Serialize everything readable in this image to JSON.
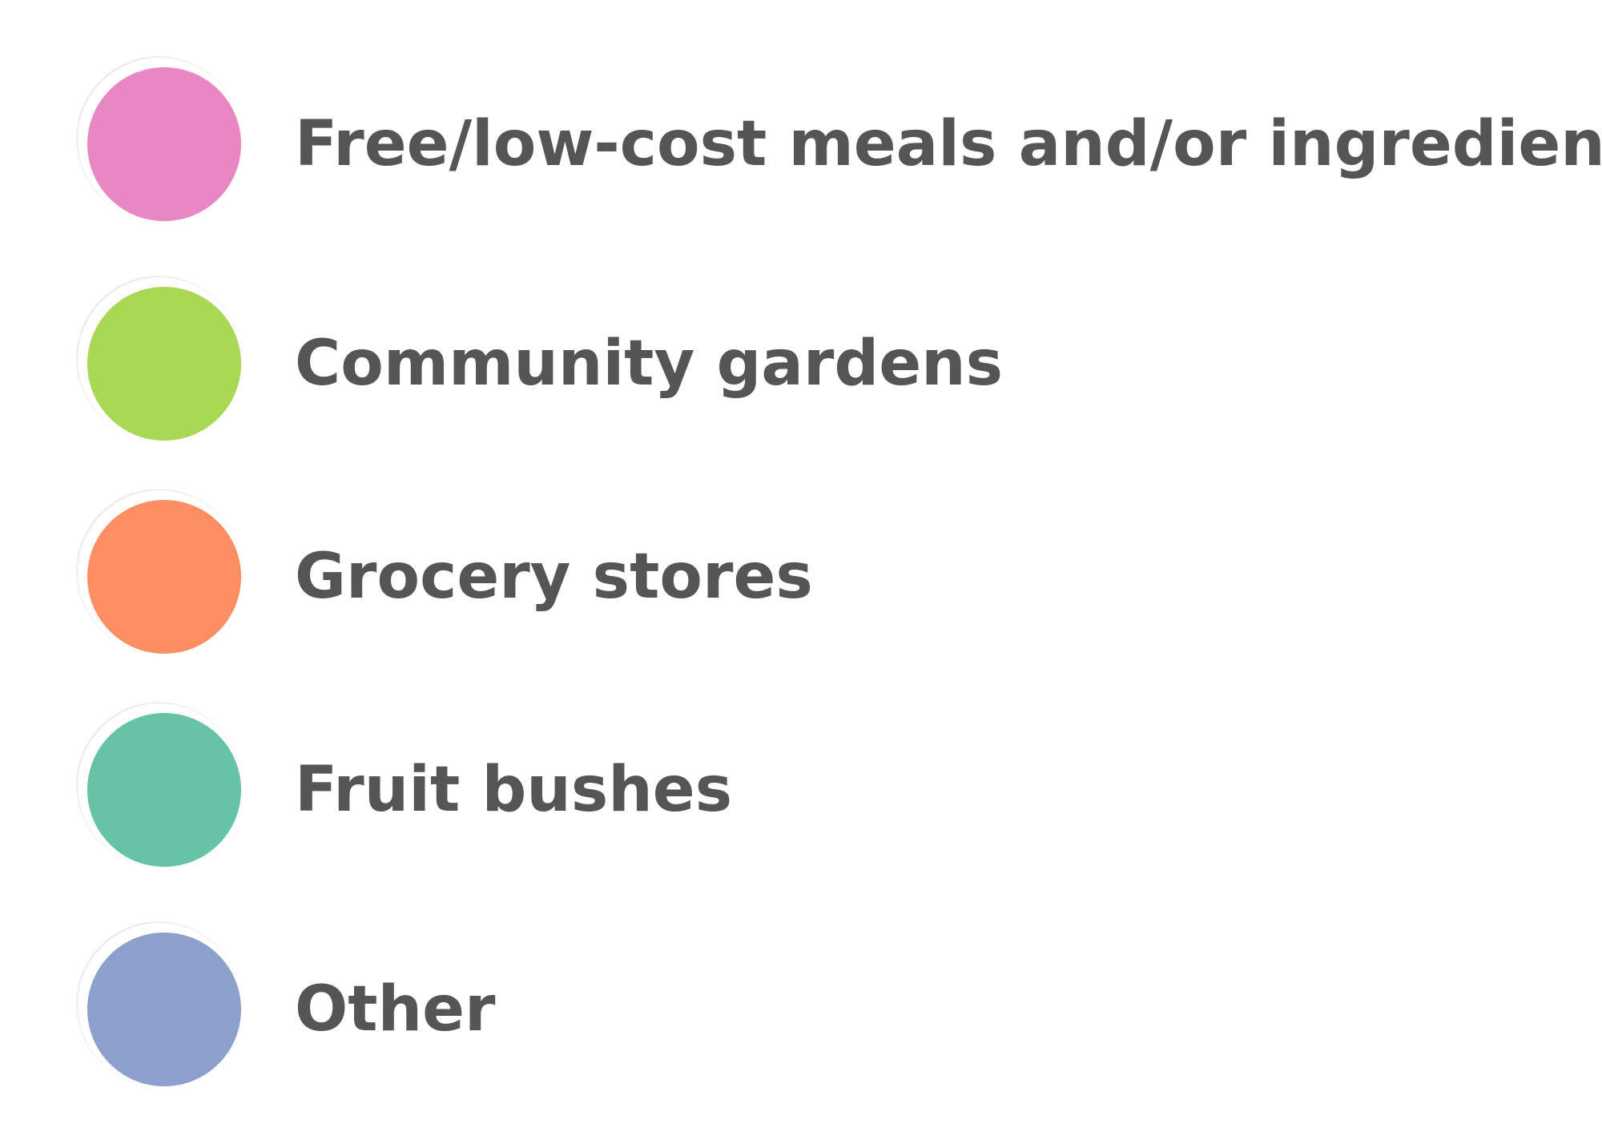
{
  "legend": {
    "items": [
      {
        "label": "Free/low-cost meals and/or ingredients",
        "color": "#E788C2"
      },
      {
        "label": "Community gardens",
        "color": "#A8D854"
      },
      {
        "label": "Grocery stores",
        "color": "#FD8D62"
      },
      {
        "label": "Fruit bushes",
        "color": "#66C3A5"
      },
      {
        "label": "Other",
        "color": "#8DA0CB"
      }
    ]
  }
}
